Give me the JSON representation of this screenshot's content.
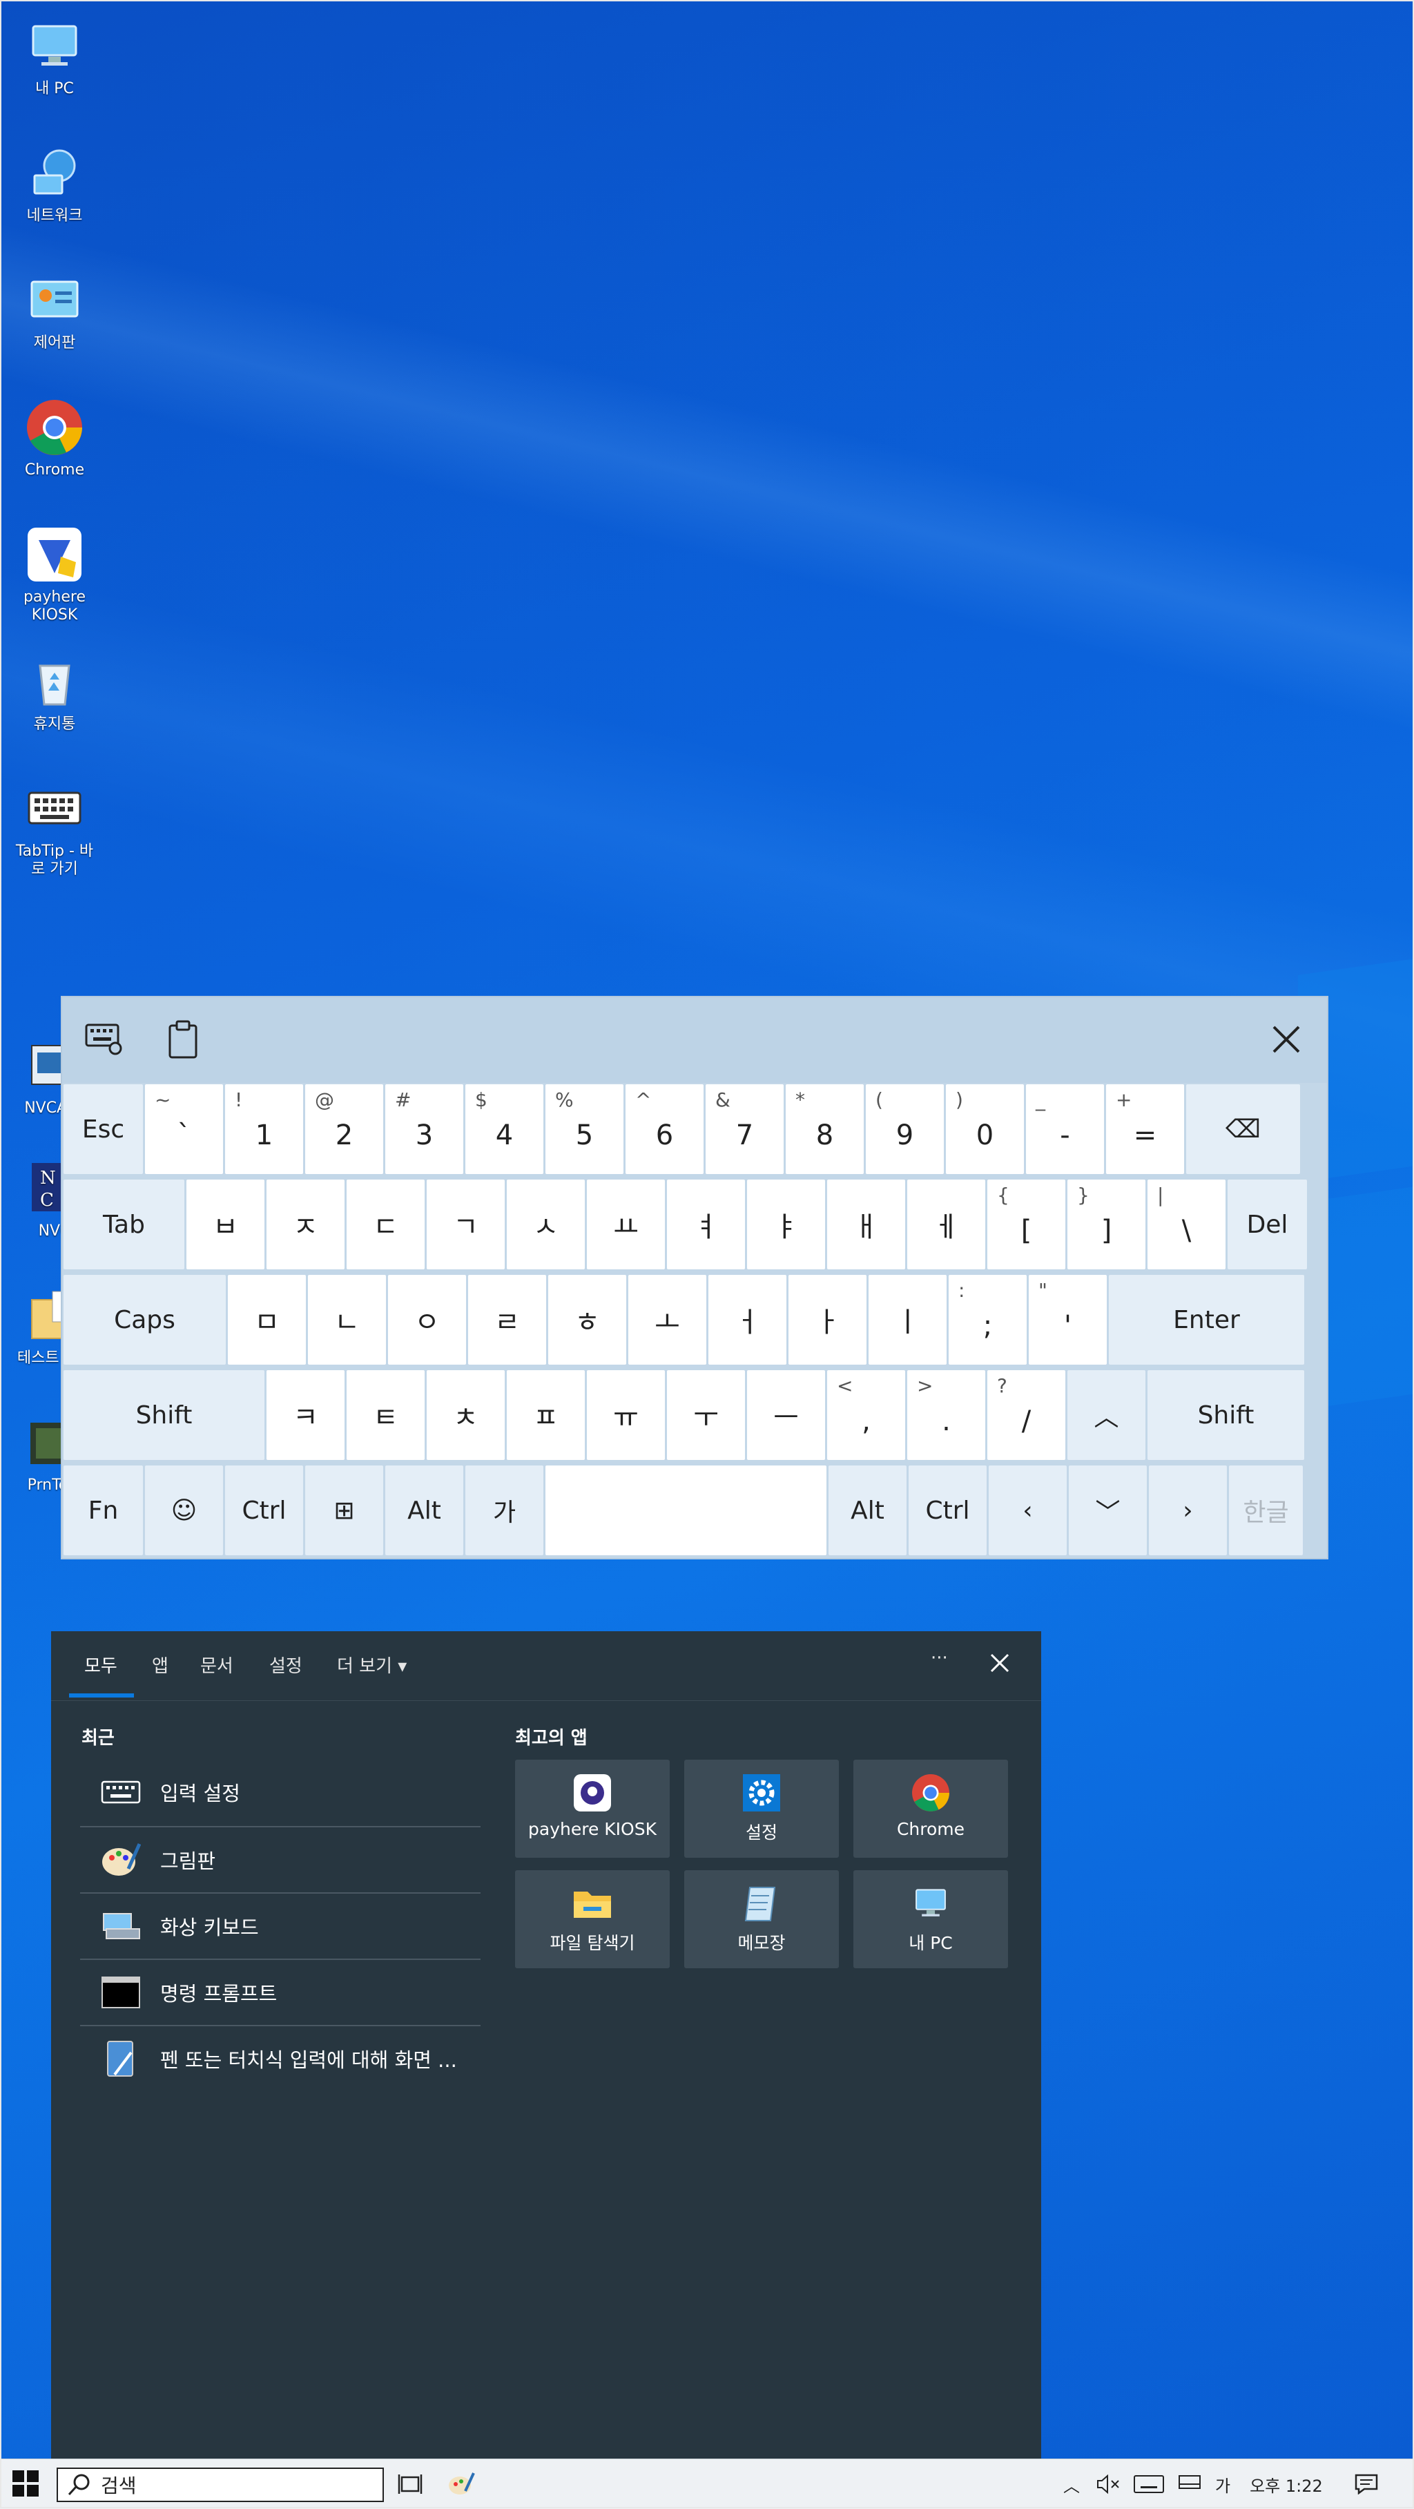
{
  "desktop": {
    "icons": [
      {
        "label": "내 PC",
        "icon": "computer-icon"
      },
      {
        "label": "네트워크",
        "icon": "network-icon"
      },
      {
        "label": "제어판",
        "icon": "control-panel-icon"
      },
      {
        "label": "Chrome",
        "icon": "chrome-icon"
      },
      {
        "label": "payhere KIOSK",
        "icon": "payhere-icon"
      },
      {
        "label": "휴지통",
        "icon": "recycle-bin-icon"
      },
      {
        "label": "TabTip - 바로 가기",
        "icon": "keyboard-icon"
      },
      {
        "label": "NVCATS",
        "icon": "app-icon"
      },
      {
        "label": "NVC",
        "icon": "app-icon"
      },
      {
        "label": "테스트 삭제",
        "icon": "folder-icon"
      },
      {
        "label": "PrnTest",
        "icon": "app-icon"
      }
    ]
  },
  "keyboard": {
    "row1": [
      {
        "main": "Esc",
        "sub": "",
        "fn": true
      },
      {
        "main": "`",
        "sub": "~"
      },
      {
        "main": "1",
        "sub": "!"
      },
      {
        "main": "2",
        "sub": "@"
      },
      {
        "main": "3",
        "sub": "#"
      },
      {
        "main": "4",
        "sub": "$"
      },
      {
        "main": "5",
        "sub": "%"
      },
      {
        "main": "6",
        "sub": "^"
      },
      {
        "main": "7",
        "sub": "&"
      },
      {
        "main": "8",
        "sub": "*"
      },
      {
        "main": "9",
        "sub": "("
      },
      {
        "main": "0",
        "sub": ")"
      },
      {
        "main": "-",
        "sub": "_"
      },
      {
        "main": "=",
        "sub": "+"
      },
      {
        "main": "⌫",
        "sub": "",
        "fn": true
      }
    ],
    "row2": [
      {
        "main": "Tab",
        "sub": "",
        "fn": true
      },
      {
        "main": "ㅂ",
        "sub": ""
      },
      {
        "main": "ㅈ",
        "sub": ""
      },
      {
        "main": "ㄷ",
        "sub": ""
      },
      {
        "main": "ㄱ",
        "sub": ""
      },
      {
        "main": "ㅅ",
        "sub": ""
      },
      {
        "main": "ㅛ",
        "sub": ""
      },
      {
        "main": "ㅕ",
        "sub": ""
      },
      {
        "main": "ㅑ",
        "sub": ""
      },
      {
        "main": "ㅐ",
        "sub": ""
      },
      {
        "main": "ㅔ",
        "sub": ""
      },
      {
        "main": "[",
        "sub": "{"
      },
      {
        "main": "]",
        "sub": "}"
      },
      {
        "main": "\\",
        "sub": "|"
      },
      {
        "main": "Del",
        "sub": "",
        "fn": true
      }
    ],
    "row3": [
      {
        "main": "Caps",
        "sub": "",
        "fn": true
      },
      {
        "main": "ㅁ",
        "sub": ""
      },
      {
        "main": "ㄴ",
        "sub": ""
      },
      {
        "main": "ㅇ",
        "sub": ""
      },
      {
        "main": "ㄹ",
        "sub": ""
      },
      {
        "main": "ㅎ",
        "sub": ""
      },
      {
        "main": "ㅗ",
        "sub": ""
      },
      {
        "main": "ㅓ",
        "sub": ""
      },
      {
        "main": "ㅏ",
        "sub": ""
      },
      {
        "main": "ㅣ",
        "sub": ""
      },
      {
        "main": ";",
        "sub": ":"
      },
      {
        "main": "'",
        "sub": "\""
      },
      {
        "main": "Enter",
        "sub": "",
        "fn": true
      }
    ],
    "row4": [
      {
        "main": "Shift",
        "sub": "",
        "fn": true
      },
      {
        "main": "ㅋ",
        "sub": ""
      },
      {
        "main": "ㅌ",
        "sub": ""
      },
      {
        "main": "ㅊ",
        "sub": ""
      },
      {
        "main": "ㅍ",
        "sub": ""
      },
      {
        "main": "ㅠ",
        "sub": ""
      },
      {
        "main": "ㅜ",
        "sub": ""
      },
      {
        "main": "ㅡ",
        "sub": ""
      },
      {
        "main": ",",
        "sub": "<"
      },
      {
        "main": ".",
        "sub": ">"
      },
      {
        "main": "/",
        "sub": "?"
      },
      {
        "main": "︿",
        "sub": "",
        "fn": true
      },
      {
        "main": "Shift",
        "sub": "",
        "fn": true
      }
    ],
    "row5": [
      {
        "main": "Fn",
        "sub": "",
        "fn": true
      },
      {
        "main": "☺",
        "sub": "",
        "fn": true
      },
      {
        "main": "Ctrl",
        "sub": "",
        "fn": true
      },
      {
        "main": "⊞",
        "sub": "",
        "fn": true
      },
      {
        "main": "Alt",
        "sub": "",
        "fn": true
      },
      {
        "main": "가",
        "sub": "",
        "fn": true
      },
      {
        "main": "",
        "sub": ""
      },
      {
        "main": "Alt",
        "sub": "",
        "fn": true
      },
      {
        "main": "Ctrl",
        "sub": "",
        "fn": true
      },
      {
        "main": "‹",
        "sub": "",
        "fn": true
      },
      {
        "main": "﹀",
        "sub": "",
        "fn": true
      },
      {
        "main": "›",
        "sub": "",
        "fn": true
      },
      {
        "main": "한글",
        "sub": "",
        "fn": true,
        "dim": true
      }
    ]
  },
  "search_panel": {
    "tabs": [
      "모두",
      "앱",
      "문서",
      "설정",
      "더 보기 ▾"
    ],
    "more_label": "···",
    "recent_title": "최근",
    "recent": [
      {
        "label": "입력 설정",
        "icon": "keyboard-icon"
      },
      {
        "label": "그림판",
        "icon": "paint-icon"
      },
      {
        "label": "화상 키보드",
        "icon": "onscreen-keyboard-icon"
      },
      {
        "label": "명령 프롬프트",
        "icon": "command-prompt-icon"
      },
      {
        "label": "펜 또는 터치식 입력에 대해 화면 ...",
        "icon": "pen-touch-icon"
      }
    ],
    "top_apps_title": "최고의 앱",
    "top_apps": [
      {
        "label": "payhere KIOSK",
        "icon": "payhere-icon"
      },
      {
        "label": "설정",
        "icon": "settings-gear-icon"
      },
      {
        "label": "Chrome",
        "icon": "chrome-icon"
      },
      {
        "label": "파일 탐색기",
        "icon": "file-explorer-icon"
      },
      {
        "label": "메모장",
        "icon": "notepad-icon"
      },
      {
        "label": "내 PC",
        "icon": "computer-icon"
      }
    ]
  },
  "taskbar": {
    "search_value": "검색",
    "time": "오후 1:22",
    "ime": "가"
  }
}
